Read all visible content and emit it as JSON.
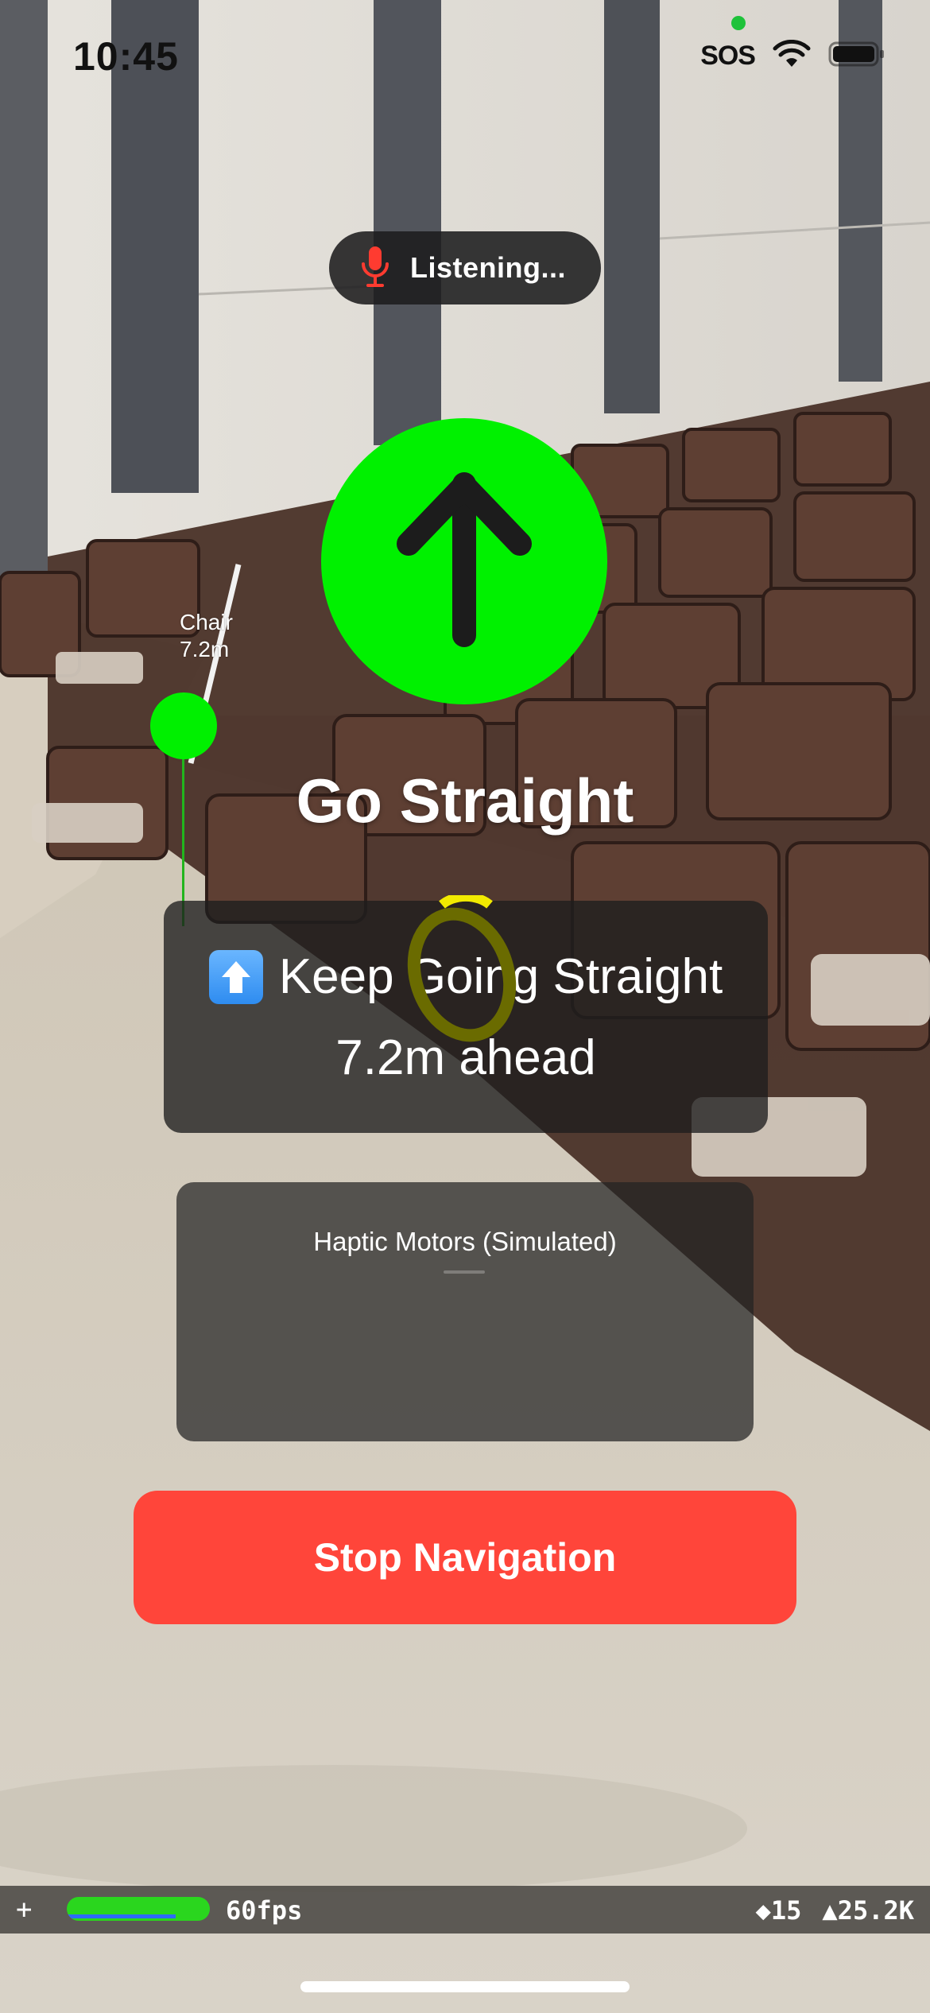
{
  "status_bar": {
    "time": "10:45",
    "sos": "SOS"
  },
  "listening": {
    "label": "Listening...",
    "mic_color": "#ff3b30"
  },
  "waypoint": {
    "name": "Chair",
    "distance": "7.2m",
    "color": "#00f000"
  },
  "direction": {
    "icon": "arrow-up-icon",
    "color": "#00f100"
  },
  "instruction": {
    "title": "Go Straight",
    "detail": "Keep Going Straight",
    "distance": "7.2m ahead",
    "emoji": "up-arrow-emoji"
  },
  "haptic": {
    "title": "Haptic Motors (Simulated)"
  },
  "actions": {
    "stop_label": "Stop Navigation",
    "stop_color": "#ff453a"
  },
  "stats": {
    "plus": "+",
    "fps": "60fps",
    "fps_fill": 0.95,
    "nodes": "◆15",
    "triangles": "▲25.2K"
  }
}
